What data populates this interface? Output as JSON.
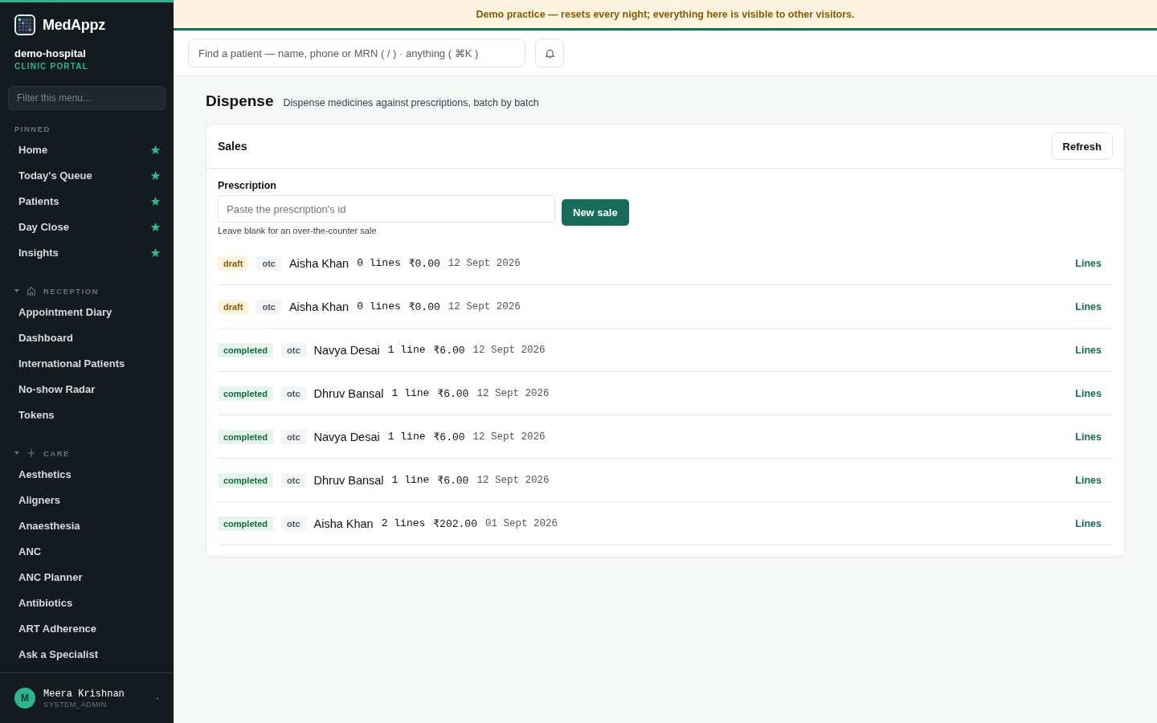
{
  "banner": "Demo practice — resets every night; everything here is visible to other visitors.",
  "sidebar": {
    "brand": "MedAppz",
    "tenant": "demo-hospital",
    "portal": "CLINIC PORTAL",
    "filter_placeholder": "Filter this menu...",
    "pinned_title": "PINNED",
    "pinned": [
      {
        "label": "Home",
        "starred": true
      },
      {
        "label": "Today's Queue",
        "starred": true
      },
      {
        "label": "Patients",
        "starred": true
      },
      {
        "label": "Day Close",
        "starred": true
      },
      {
        "label": "Insights",
        "starred": true
      }
    ],
    "sections": [
      {
        "title": "RECEPTION",
        "kind": "house",
        "expanded": true,
        "items": [
          "Appointment Diary",
          "Dashboard",
          "International Patients",
          "No-show Radar",
          "Tokens"
        ]
      },
      {
        "title": "CARE",
        "kind": "plus",
        "expanded": true,
        "items": [
          "Aesthetics",
          "Aligners",
          "Anaesthesia",
          "ANC",
          "ANC Planner",
          "Antibiotics",
          "ART Adherence",
          "Ask a Specialist"
        ]
      }
    ],
    "user": {
      "initial": "M",
      "name": "Meera Krishnan",
      "role": "SYSTEM_ADMIN"
    }
  },
  "search": {
    "placeholder": "Find a patient — name, phone or MRN ( / ) · anything ( ⌘K )"
  },
  "page": {
    "title": "Dispense",
    "subtitle": "Dispense medicines against prescriptions, batch by batch"
  },
  "card": {
    "title": "Sales",
    "refresh": "Refresh",
    "field_label": "Prescription",
    "field_placeholder": "Paste the prescription's id",
    "hint": "Leave blank for an over-the-counter sale",
    "new_sale": "New sale"
  },
  "sales": [
    {
      "status": "draft",
      "kind": "draft",
      "type": "otc",
      "patient": "Aisha Khan",
      "lines": "0 lines",
      "amount": "₹0.00",
      "date": "12 Sept 2026",
      "action": "Lines"
    },
    {
      "status": "draft",
      "kind": "draft",
      "type": "otc",
      "patient": "Aisha Khan",
      "lines": "0 lines",
      "amount": "₹0.00",
      "date": "12 Sept 2026",
      "action": "Lines"
    },
    {
      "status": "completed",
      "kind": "completed",
      "type": "otc",
      "patient": "Navya Desai",
      "lines": "1 line",
      "amount": "₹6.00",
      "date": "12 Sept 2026",
      "action": "Lines"
    },
    {
      "status": "completed",
      "kind": "completed",
      "type": "otc",
      "patient": "Dhruv Bansal",
      "lines": "1 line",
      "amount": "₹6.00",
      "date": "12 Sept 2026",
      "action": "Lines"
    },
    {
      "status": "completed",
      "kind": "completed",
      "type": "otc",
      "patient": "Navya Desai",
      "lines": "1 line",
      "amount": "₹6.00",
      "date": "12 Sept 2026",
      "action": "Lines"
    },
    {
      "status": "completed",
      "kind": "completed",
      "type": "otc",
      "patient": "Dhruv Bansal",
      "lines": "1 line",
      "amount": "₹6.00",
      "date": "12 Sept 2026",
      "action": "Lines"
    },
    {
      "status": "completed",
      "kind": "completed",
      "type": "otc",
      "patient": "Aisha Khan",
      "lines": "2 lines",
      "amount": "₹202.00",
      "date": "01 Sept 2026",
      "action": "Lines"
    }
  ]
}
